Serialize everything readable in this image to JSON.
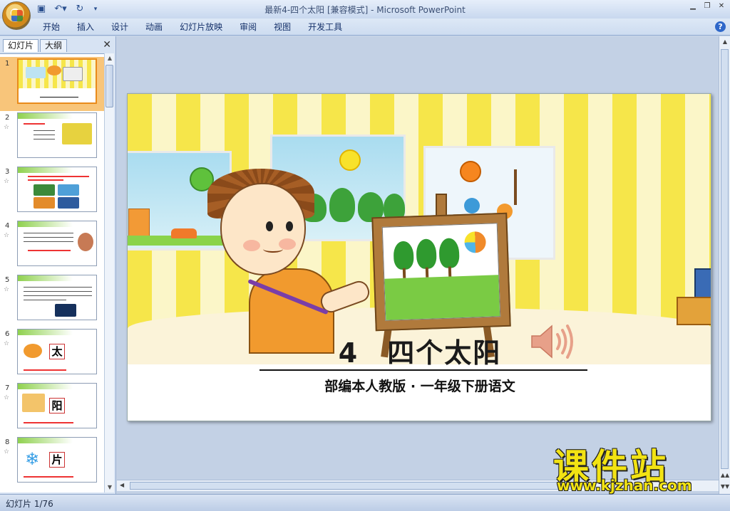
{
  "window": {
    "title": "最新4-四个太阳 [兼容模式] - Microsoft PowerPoint"
  },
  "ribbon": {
    "tabs": [
      "开始",
      "插入",
      "设计",
      "动画",
      "幻灯片放映",
      "审阅",
      "视图",
      "开发工具"
    ]
  },
  "left_panel": {
    "tabs": [
      "幻灯片",
      "大纲"
    ],
    "slide_numbers": [
      "1",
      "2",
      "3",
      "4",
      "5",
      "6",
      "7",
      "8"
    ],
    "thumb_chars": {
      "slide6": "太",
      "slide7": "阳",
      "slide8": "片"
    }
  },
  "slide": {
    "title": "4　四个太阳",
    "subtitle": "部编本人教版 · 一年级下册语文"
  },
  "status": {
    "slide_indicator": "幻灯片 1/76"
  },
  "watermark": {
    "line1": "课件站",
    "line2": "www.kjzhan.com"
  },
  "colors": {
    "wall_stripe": "#f6e64a",
    "accent_orange": "#e98b1b",
    "watermark_yellow": "#f2e313"
  }
}
